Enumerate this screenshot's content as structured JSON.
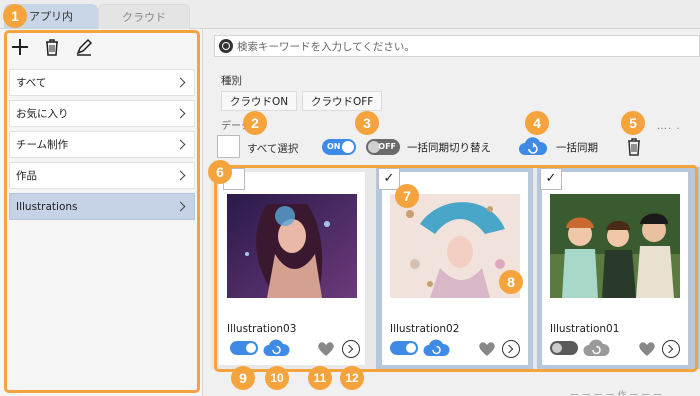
{
  "tabs": [
    {
      "label": "アプリ内"
    },
    {
      "label": "クラウド"
    }
  ],
  "sidebar": {
    "items": [
      {
        "label": "すべて"
      },
      {
        "label": "お気に入り"
      },
      {
        "label": "チーム制作"
      },
      {
        "label": "作品"
      },
      {
        "label": "Illustrations"
      }
    ]
  },
  "search": {
    "placeholder": "検索キーワードを入力してください。"
  },
  "filter": {
    "label": "種別",
    "cloud_on": "クラウドON",
    "cloud_off": "クラウドOFF"
  },
  "controls": {
    "select_all": "すべて選択",
    "toggle_on": "ON",
    "toggle_off": "OFF",
    "bulk_sync_toggle_label": "一括同期切り替え",
    "bulk_sync_label": "一括同期",
    "more": "…. .",
    "partial_label": "データ  ト"
  },
  "cards": [
    {
      "title": "Illustration03",
      "checked": false,
      "sync": "on"
    },
    {
      "title": "Illustration02",
      "checked": true,
      "sync": "on"
    },
    {
      "title": "Illustration01",
      "checked": true,
      "sync": "off"
    }
  ],
  "callouts": [
    "1",
    "2",
    "3",
    "4",
    "5",
    "6",
    "7",
    "8",
    "9",
    "10",
    "11",
    "12"
  ],
  "colors": {
    "accent": "#3d8be6",
    "callout": "#f5a33d",
    "selected": "#c6d3e6"
  },
  "footer_hint": "ー ー ー ー 作 ー ー ー"
}
